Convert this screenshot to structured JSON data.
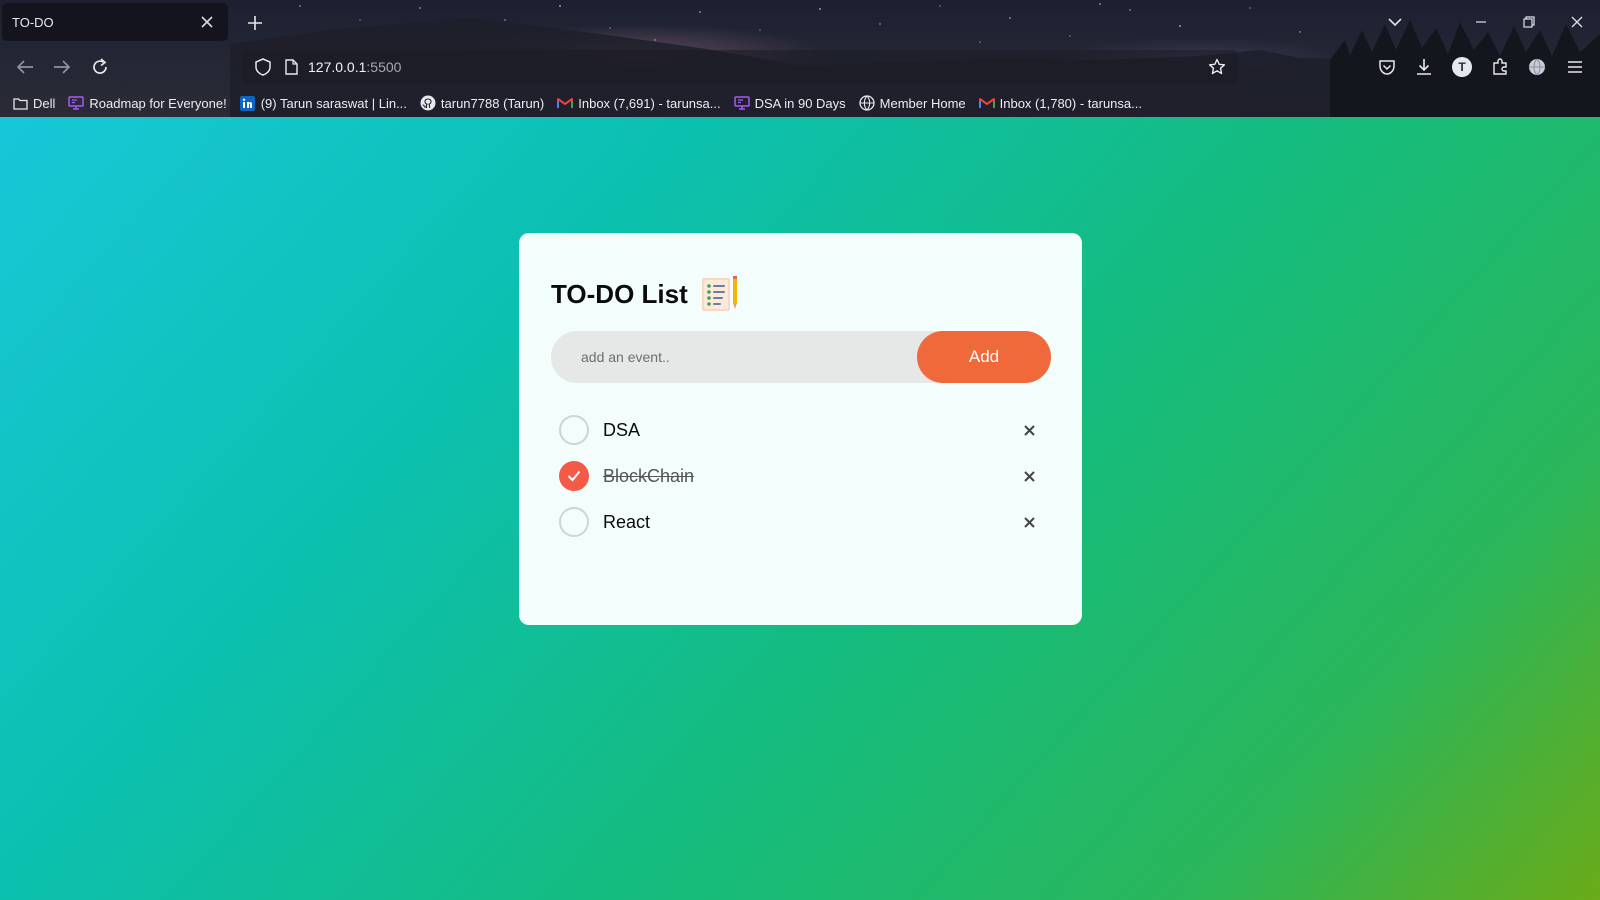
{
  "browser": {
    "tab_title": "TO-DO",
    "url_host": "127.0.0.1",
    "url_port": ":5500",
    "avatar_letter": "T",
    "icons": {
      "tab_close": "close-icon",
      "new_tab": "plus-icon",
      "back": "arrow-left-icon",
      "forward": "arrow-right-icon",
      "reload": "reload-icon",
      "shield": "shield-icon",
      "page": "page-icon",
      "bookmark_star": "star-icon",
      "pocket": "pocket-icon",
      "downloads": "download-icon",
      "extensions": "puzzle-icon",
      "globe": "globe-icon",
      "menu": "hamburger-icon"
    }
  },
  "bookmarks": [
    {
      "label": "Dell",
      "icon": "folder-icon"
    },
    {
      "label": "Roadmap for Everyone!",
      "icon": "monitor-icon"
    },
    {
      "label": "(9) Tarun saraswat | Lin...",
      "icon": "linkedin-icon"
    },
    {
      "label": "tarun7788 (Tarun)",
      "icon": "github-icon"
    },
    {
      "label": "Inbox (7,691) - tarunsa...",
      "icon": "gmail-icon"
    },
    {
      "label": "DSA in 90 Days",
      "icon": "monitor-icon"
    },
    {
      "label": "Member Home",
      "icon": "globe-icon"
    },
    {
      "label": "Inbox (1,780) - tarunsa...",
      "icon": "gmail-icon"
    }
  ],
  "app": {
    "title": "TO-DO List",
    "title_icon": "notepad-checklist-icon",
    "input_placeholder": "add an event..",
    "add_label": "Add",
    "todos": [
      {
        "text": "DSA",
        "done": false
      },
      {
        "text": "BlockChain",
        "done": true
      },
      {
        "text": "React",
        "done": false
      }
    ],
    "remove_icon": "close-icon"
  },
  "colors": {
    "accent_button": "#f0693a",
    "checked": "#f45a45",
    "card_bg": "#f2fdfc",
    "gradient_start": "#18c7d8",
    "gradient_end": "#6aab18"
  }
}
